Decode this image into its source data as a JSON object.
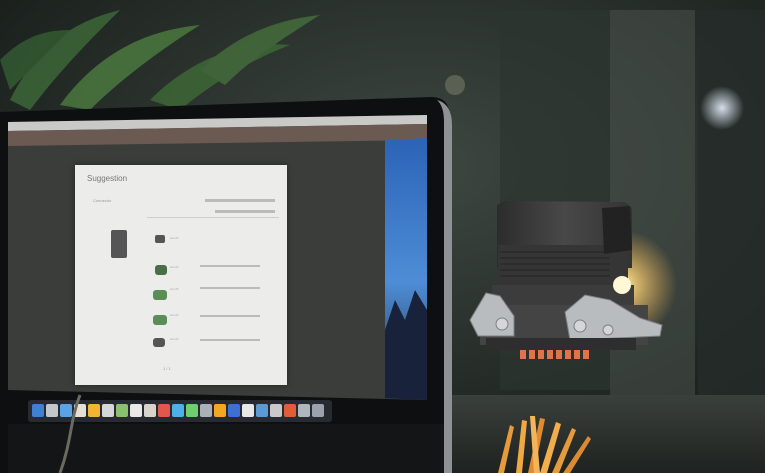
{
  "scene": {
    "description_objects": [
      "desk-monitor",
      "connector-housing",
      "pencil-cup",
      "plant"
    ],
    "monitor": {
      "window_title": "Suggestion",
      "section_label": "Connector",
      "rows": [
        "Han B",
        "Han B",
        "Han B",
        "Han B",
        "Han B"
      ],
      "footer": "1 / 1"
    },
    "colors": {
      "background": "#1c2320",
      "screen_bg": "#3b3d3a",
      "window_bg": "#ececea",
      "housing": "#3a3a3a",
      "metal": "#b9bcbf",
      "contacts": "#e2724a",
      "pencils": "#e59a3c",
      "glow": "#ffe39a"
    }
  }
}
